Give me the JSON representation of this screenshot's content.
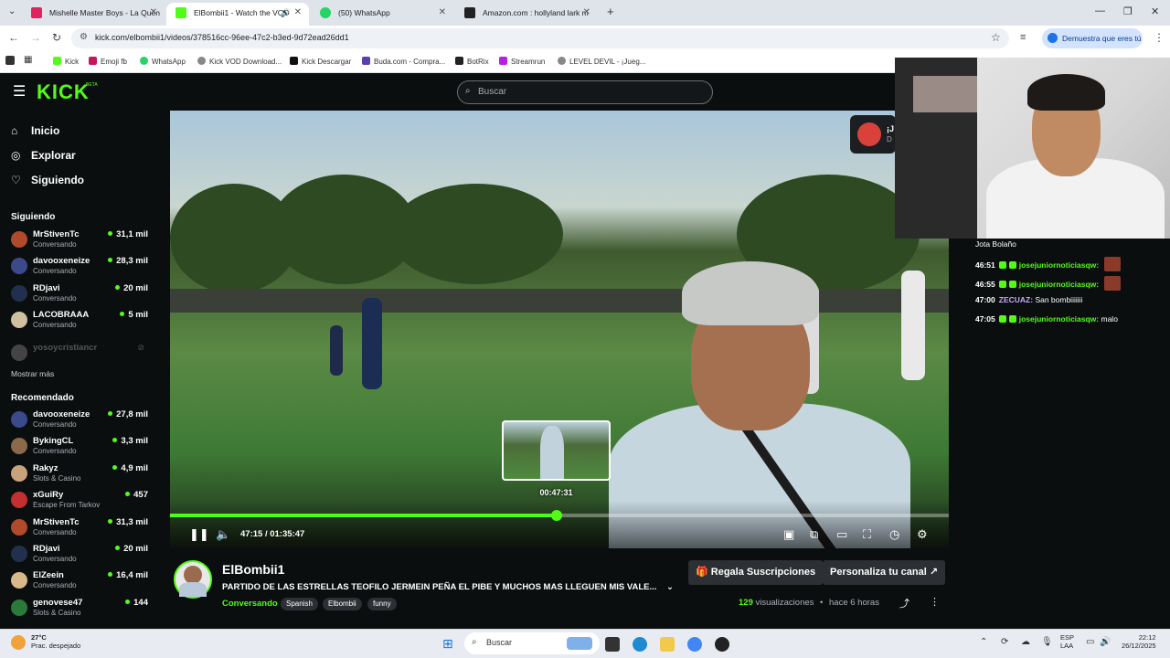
{
  "browser": {
    "tabs": [
      {
        "label": "Mishelle Master Boys - La Quen",
        "fav_color": "#e0245e"
      },
      {
        "label": "ElBombii1 - Watch the VOD",
        "fav_color": "#53fc18"
      },
      {
        "label": "(50) WhatsApp",
        "fav_color": "#25d366"
      },
      {
        "label": "Amazon.com : hollyland lark m",
        "fav_color": "#222222"
      }
    ],
    "new_tab": "+",
    "url": "kick.com/elbombii1/videos/378516cc-96ee-47c2-b3ed-9d72ead26dd1",
    "verify_label": "Demuestra que eres tú",
    "bookmarks": [
      "Kick",
      "Emoji fb",
      "WhatsApp",
      "Kick VOD Download...",
      "Kick Descargar",
      "Buda.com - Compra...",
      "BotRix",
      "Streamrun",
      "LEVEL DEVIL - ¡Jueg..."
    ]
  },
  "kick": {
    "logo": "KICK",
    "logo_beta": "BETA",
    "search_placeholder": "Buscar",
    "nav": [
      "Inicio",
      "Explorar",
      "Siguiendo"
    ],
    "following_header": "Siguiendo",
    "following": [
      {
        "name": "MrStivenTc",
        "sub": "Conversando",
        "viewers": "31,1 mil",
        "color": "#b14a2a"
      },
      {
        "name": "davooxeneize",
        "sub": "Conversando",
        "viewers": "28,3 mil",
        "color": "#3b4a8a"
      },
      {
        "name": "RDjavi",
        "sub": "Conversando",
        "viewers": "20 mil",
        "color": "#22304f"
      },
      {
        "name": "LACOBRAAA",
        "sub": "Conversando",
        "viewers": "5 mil",
        "color": "#d0c0a0"
      }
    ],
    "offline_channel": "yosoycristiancr",
    "show_more": "Mostrar más",
    "recommended_header": "Recomendado",
    "recommended": [
      {
        "name": "davooxeneize",
        "sub": "Conversando",
        "viewers": "27,8 mil",
        "color": "#3b4a8a"
      },
      {
        "name": "BykingCL",
        "sub": "Conversando",
        "viewers": "3,3 mil",
        "color": "#8a6a4a"
      },
      {
        "name": "Rakyz",
        "sub": "Slots & Casino",
        "viewers": "4,9 mil",
        "color": "#c9a27a"
      },
      {
        "name": "xGuiRy",
        "sub": "Escape From Tarkov",
        "viewers": "457",
        "color": "#c23030"
      },
      {
        "name": "MrStivenTc",
        "sub": "Conversando",
        "viewers": "31,3 mil",
        "color": "#b14a2a"
      },
      {
        "name": "RDjavi",
        "sub": "Conversando",
        "viewers": "20 mil",
        "color": "#22304f"
      },
      {
        "name": "ElZeein",
        "sub": "Conversando",
        "viewers": "16,4 mil",
        "color": "#d9b98a"
      },
      {
        "name": "genovese47",
        "sub": "Slots & Casino",
        "viewers": "144",
        "color": "#2a7a3a"
      }
    ],
    "player": {
      "elapsed": "47:15",
      "duration": "01:35:47",
      "progress": 0.493,
      "hover_fraction": 0.496,
      "hover_time": "00:47:31"
    },
    "notification": {
      "title": "¡J",
      "sub": "D"
    },
    "chat": [
      {
        "ts": "",
        "user": "",
        "text": "Jota Bolaño",
        "badge": false,
        "emote": false
      },
      {
        "ts": "46:51",
        "user": "josejuniornoticiasqw:",
        "text": "",
        "badge": true,
        "emote": true
      },
      {
        "ts": "46:55",
        "user": "josejuniornoticiasqw:",
        "text": "",
        "badge": true,
        "emote": true
      },
      {
        "ts": "47:00",
        "user": "ZECUAZ:",
        "text": "San bombiiiiiii",
        "badge": false,
        "emote": false
      },
      {
        "ts": "47:05",
        "user": "josejuniornoticiasqw:",
        "text": "malo",
        "badge": true,
        "emote": false
      }
    ],
    "colors": {
      "accent": "#53fc18",
      "zecuaz": "#c9a6ff"
    },
    "video_info": {
      "channel": "ElBombii1",
      "title": "PARTIDO DE LAS ESTRELLAS TEOFILO JERMEIN PEÑA EL PIBE Y MUCHOS MAS LLEGUEN MIS VALE...",
      "category": "Conversando",
      "tags": [
        "Spanish",
        "Elbombii",
        "funny"
      ],
      "gift_button": "Regala Suscripciones",
      "customize_button": "Personaliza tu canal",
      "views_count": "129",
      "views_label": "visualizaciones",
      "separator": "•",
      "ago": "hace 6 horas"
    }
  },
  "taskbar": {
    "weather_temp": "27°C",
    "weather_desc": "Prac. despejado",
    "search": "Buscar",
    "lang1": "ESP",
    "lang2": "LAA",
    "time": "22:12",
    "date": "26/12/2025"
  }
}
